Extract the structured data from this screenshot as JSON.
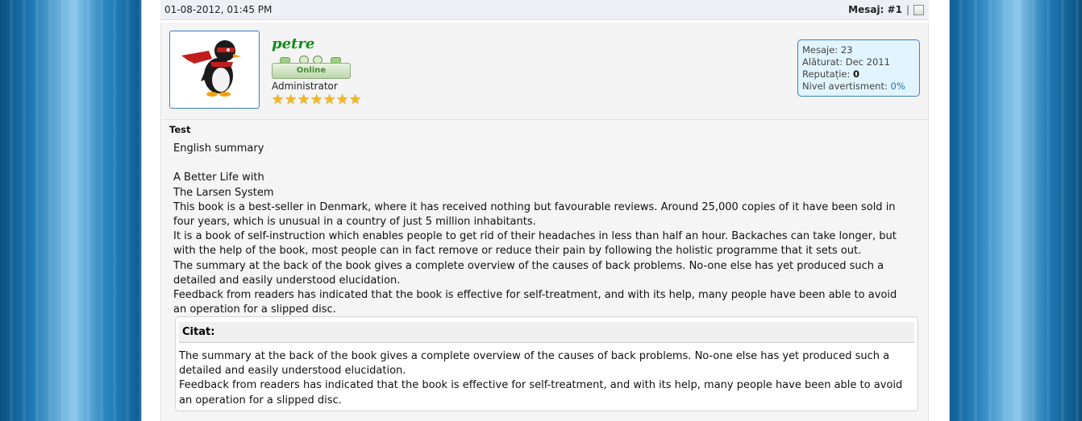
{
  "post": {
    "date": "01-08-2012, 01:45 PM",
    "number_label": "Mesaj: #1",
    "separator": "|"
  },
  "user": {
    "name": "petre",
    "status": "Online",
    "title": "Administrator",
    "stars": 7,
    "stats": {
      "posts_label": "Mesaje:",
      "posts_value": "23",
      "joined_label": "Alăturat:",
      "joined_value": "Dec 2011",
      "rep_label": "Reputație:",
      "rep_value": "0",
      "warn_label": "Nivel avertisment:",
      "warn_value": "0%"
    }
  },
  "content": {
    "title": "Test",
    "paragraphs": [
      "English summary",
      "",
      "A Better Life with",
      "The Larsen System",
      "This book is a best-seller in Denmark, where it has received nothing but favourable reviews. Around 25,000 copies of it have been sold in four years, which is unusual in a country of just 5 million inhabitants.",
      "It is a book of self-instruction which enables people to get rid of their headaches in less than half an hour. Backaches can take longer, but with the help of the book, most people can in fact remove or reduce their pain by following the holistic programme that it sets out.",
      "The summary at the back of the book gives a complete overview of the causes of back problems. No-one else has yet produced such a detailed and easily understood elucidation.",
      "Feedback from readers has indicated that the book is effective for self-treatment, and with its help, many people have been able to avoid an operation for a slipped disc."
    ],
    "quote": {
      "label": "Citat:",
      "paragraphs": [
        "The summary at the back of the book gives a complete overview of the causes of back problems. No-one else has yet produced such a detailed and easily understood elucidation.",
        "Feedback from readers has indicated that the book is effective for self-treatment, and with its help, many people have been able to avoid an operation for a slipped disc."
      ]
    }
  },
  "colors": {
    "username": "#168a1d",
    "stats_bg": "#e1f4ff",
    "stats_border": "#3b7fbf",
    "link": "#1a72b8"
  }
}
